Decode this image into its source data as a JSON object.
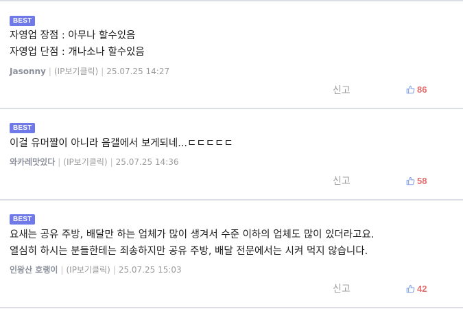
{
  "comments": [
    {
      "badge": "BEST",
      "lines": [
        "자영업 장점 : 아무나 할수있음",
        "자영업 단점 : 개나소나 할수있음"
      ],
      "nickname": "Jasonny",
      "ip_link": "(IP보기클릭)",
      "timestamp": "25.07.25 14:27",
      "report_label": "신고",
      "likes": "86"
    },
    {
      "badge": "BEST",
      "lines": [
        "이걸 유머짤이 아니라 음갤에서 보게되네...ㄷㄷㄷㄷㄷ"
      ],
      "nickname": "와카레맛있다",
      "ip_link": "(IP보기클릭)",
      "timestamp": "25.07.25 14:36",
      "report_label": "신고",
      "likes": "58"
    },
    {
      "badge": "BEST",
      "lines": [
        "요새는 공유 주방, 배달만 하는 업체가 많이 생겨서 수준 이하의 업체도 많이 있더라고요.",
        "열심히 하시는 분들한테는 죄송하지만 공유 주방, 배달 전문에서는 시켜 먹지 않습니다."
      ],
      "nickname": "인왕산 호랭이",
      "ip_link": "(IP보기클릭)",
      "timestamp": "25.07.25 15:03",
      "report_label": "신고",
      "likes": "42"
    }
  ],
  "icons": {
    "like": "thumbs-up-icon"
  },
  "colors": {
    "badge_bg": "#6f79e8",
    "like_count": "#e26f6f",
    "like_icon": "#7b9be8",
    "divider": "#dcdee6"
  }
}
